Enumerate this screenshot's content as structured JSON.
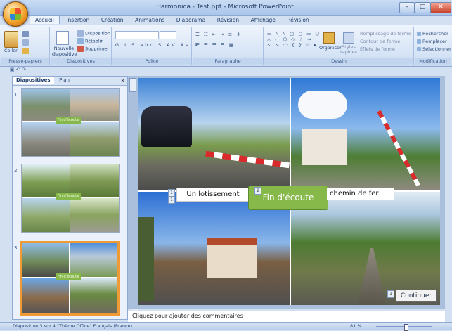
{
  "window": {
    "title": "Harmonica - Test.ppt - Microsoft PowerPoint"
  },
  "tabs": [
    "Accueil",
    "Insertion",
    "Création",
    "Animations",
    "Diaporama",
    "Révision",
    "Affichage",
    "Révision"
  ],
  "ribbon": {
    "groups": [
      "Presse-papiers",
      "Diapositives",
      "Police",
      "Paragraphe",
      "Dessin",
      "Modification"
    ],
    "coller": "Coller",
    "nouvelle_diapo": "Nouvelle diapositive",
    "disposition": "Disposition",
    "retablir": "Rétablir",
    "supprimer": "Supprimer",
    "organiser": "Organiser",
    "styles_rapides": "Styles rapides",
    "remplissage": "Remplissage de forme",
    "contour": "Contour de forme",
    "effets": "Effets de forme",
    "rechercher": "Rechercher",
    "remplacer": "Remplacer",
    "selectionner": "Sélectionner"
  },
  "panel": {
    "tabs": [
      "Diapositives",
      "Plan"
    ],
    "close": "×"
  },
  "thumbs": [
    {
      "num": "1",
      "label": "Fin d'écoute"
    },
    {
      "num": "2",
      "label": "Fin d'écoute"
    },
    {
      "num": "3",
      "label": "Fin d'écoute"
    }
  ],
  "slide": {
    "label_left": "Un lotissement",
    "button_ecoute": "Fin d'écoute",
    "label_right": "chemin de fer",
    "button_continuer": "Continuer",
    "tags": [
      "1",
      "1",
      "2",
      "1"
    ]
  },
  "notes": {
    "placeholder": "Cliquez pour ajouter des commentaires"
  },
  "status": {
    "left": "Diapositive 3 sur 4    \"Thème Office\"    Français (France)",
    "zoom": "81 %"
  },
  "colors": {
    "ribbon": "#dbe7f7",
    "accent_green": "#86b84a",
    "selection": "#f09a36"
  }
}
